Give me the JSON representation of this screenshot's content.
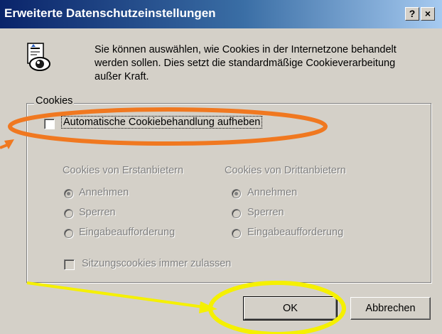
{
  "window": {
    "title": "Erweiterte Datenschutzeinstellungen",
    "help_label": "?",
    "close_label": "×"
  },
  "info": {
    "text": "Sie können auswählen, wie Cookies in der Internetzone behandelt werden sollen. Dies setzt die standardmäßige Cookieverarbeitung außer Kraft."
  },
  "cookies_group": {
    "label": "Cookies",
    "override_checkbox": {
      "label": "Automatische Cookiebehandlung aufheben",
      "checked": false
    },
    "first_party": {
      "header": "Cookies von Erstanbietern",
      "options": [
        "Annehmen",
        "Sperren",
        "Eingabeaufforderung"
      ],
      "selected": "Annehmen"
    },
    "third_party": {
      "header": "Cookies von Drittanbietern",
      "options": [
        "Annehmen",
        "Sperren",
        "Eingabeaufforderung"
      ],
      "selected": "Annehmen"
    },
    "session_checkbox": {
      "label": "Sitzungscookies immer zulassen",
      "checked": false
    }
  },
  "buttons": {
    "ok": "OK",
    "cancel": "Abbrechen"
  },
  "annotations": {
    "ellipse1_color": "#f07820",
    "ellipse2_color": "#f5f000"
  }
}
